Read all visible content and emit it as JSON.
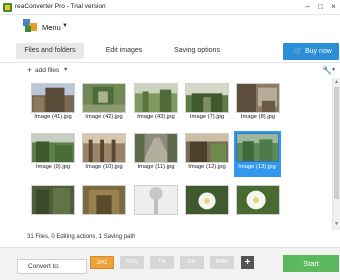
{
  "window": {
    "title": "reaConverter Pro - Trial version",
    "controls": [
      "–",
      "□",
      "×"
    ]
  },
  "menu": {
    "label": "Menu",
    "caret": "▼"
  },
  "tabs": [
    {
      "label": "Files and folders",
      "active": true
    },
    {
      "label": "Edit images",
      "active": false
    },
    {
      "label": "Saving options",
      "active": false
    }
  ],
  "buy": {
    "label": "Buy now",
    "icon": "cart-icon"
  },
  "toolbar": {
    "add_files": "add files",
    "caret": "▼"
  },
  "thumbnails": [
    {
      "caption": "Image (41).jpg",
      "selected": false
    },
    {
      "caption": "Image (42).jpg",
      "selected": false
    },
    {
      "caption": "Image (43).jpg",
      "selected": false
    },
    {
      "caption": "Image (7).jpg",
      "selected": false
    },
    {
      "caption": "Image (8).jpg",
      "selected": false
    },
    {
      "caption": "Image (9).jpg",
      "selected": false
    },
    {
      "caption": "Image (10).jpg",
      "selected": false
    },
    {
      "caption": "Image (11).jpg",
      "selected": false
    },
    {
      "caption": "Image (12).jpg",
      "selected": false
    },
    {
      "caption": "Image (13).jpg",
      "selected": true
    },
    {
      "caption": "",
      "selected": false
    },
    {
      "caption": "",
      "selected": false
    },
    {
      "caption": "",
      "selected": false
    },
    {
      "caption": "",
      "selected": false
    },
    {
      "caption": "",
      "selected": false
    }
  ],
  "status": "31 Files, 0 Editing actions, 1 Saving path",
  "bottom": {
    "convert_label": "Convert to:",
    "formats": [
      {
        "label": "JPG",
        "active": true
      },
      {
        "label": "PNG",
        "active": false
      },
      {
        "label": "TIF",
        "active": false
      },
      {
        "label": "GIF",
        "active": false
      },
      {
        "label": "BMP",
        "active": false
      }
    ],
    "plus": "+",
    "start": "Start"
  },
  "colors": {
    "accent_blue": "#2b8fd8",
    "start_green": "#5cb85c",
    "active_format": "#f0a23a",
    "selection": "#3399ee"
  }
}
